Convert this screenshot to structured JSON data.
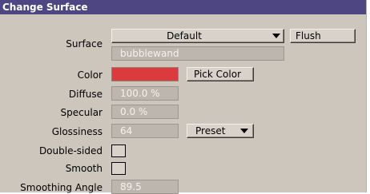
{
  "window": {
    "title": "Change Surface"
  },
  "surface": {
    "label": "Surface",
    "selected": "Default",
    "flush_label": "Flush",
    "name_value": "bubblewand"
  },
  "color": {
    "label": "Color",
    "swatch_hex": "#dd3a3d",
    "pick_label": "Pick Color"
  },
  "diffuse": {
    "label": "Diffuse",
    "value": "100.0 %"
  },
  "specular": {
    "label": "Specular",
    "value": "0.0 %"
  },
  "glossiness": {
    "label": "Glossiness",
    "value": "64",
    "preset_label": "Preset"
  },
  "double_sided": {
    "label": "Double-sided",
    "checked": false
  },
  "smooth": {
    "label": "Smooth",
    "checked": false
  },
  "smoothing_angle": {
    "label": "Smoothing Angle",
    "value": "89.5"
  },
  "colors": {
    "titlebar": "#4d4682",
    "panel": "#cdc6bd",
    "field": "#bdb6ae"
  }
}
